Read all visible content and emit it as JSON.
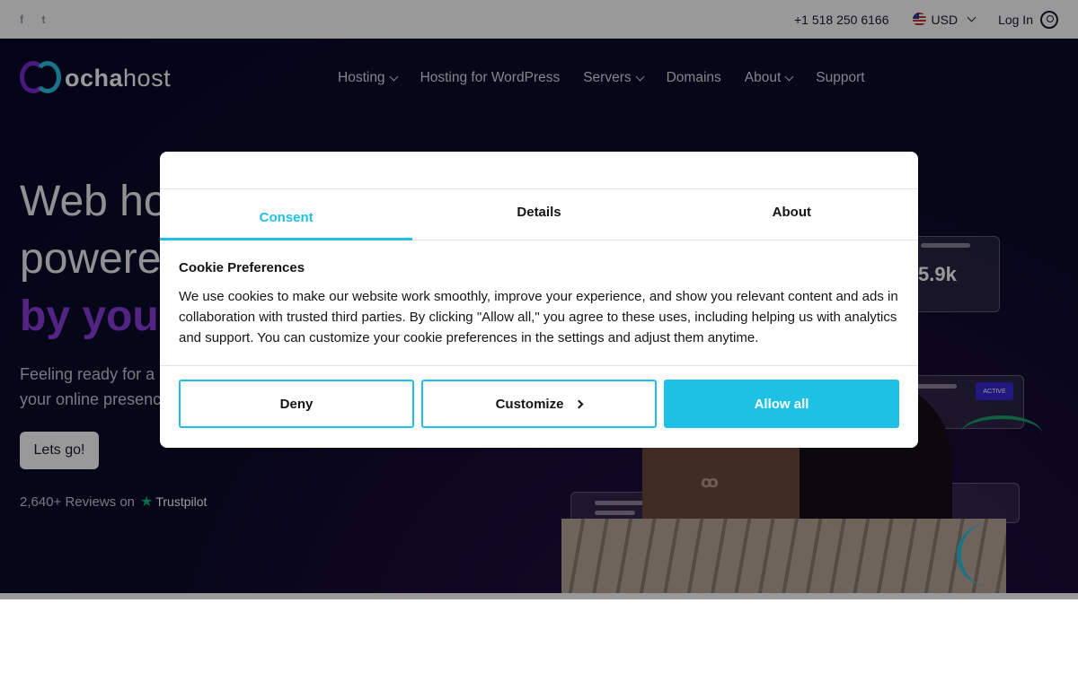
{
  "topbar": {
    "social": [
      {
        "icon": "facebook-icon",
        "glyph": "f"
      },
      {
        "icon": "twitter-icon",
        "glyph": "t"
      }
    ],
    "phone": "+1 518 250 6166",
    "currency": "USD",
    "login": "Log In"
  },
  "nav": {
    "logo_bold": "ocha",
    "logo_light": "host",
    "items": [
      {
        "label": "Hosting",
        "dropdown": true
      },
      {
        "label": "Hosting for WordPress",
        "dropdown": false
      },
      {
        "label": "Servers",
        "dropdown": true
      },
      {
        "label": "Domains",
        "dropdown": false
      },
      {
        "label": "About",
        "dropdown": true
      },
      {
        "label": "Support",
        "dropdown": false
      }
    ]
  },
  "hero": {
    "title_line1": "Web ho",
    "title_line2": "powere",
    "title_line3": "by you.",
    "subtitle_line1": "Feeling ready for a",
    "subtitle_line2": "your online presenc",
    "cta": "Lets go!",
    "reviews": "2,640+ Reviews on",
    "reviews_brand": "Trustpilot",
    "stat": "5.9k",
    "badge": "ACTIVE"
  },
  "cookie": {
    "tabs": [
      "Consent",
      "Details",
      "About"
    ],
    "active_tab": "Consent",
    "title": "Cookie Preferences",
    "text": "We use cookies to make our website work smoothly, improve your experience, and show you relevant content and ads in collaboration with trusted third parties. By clicking \"Allow all,\" you agree to these uses, including helping us with analytics and support. You can customize your cookie preferences in the settings and adjust them anytime.",
    "deny": "Deny",
    "customize": "Customize",
    "allow_all": "Allow all"
  },
  "colors": {
    "accent": "#1ec1e4",
    "brand_purple": "#8b3ddb",
    "hero_bg": "#0d0b2b",
    "trustpilot_green": "#00b67a"
  }
}
